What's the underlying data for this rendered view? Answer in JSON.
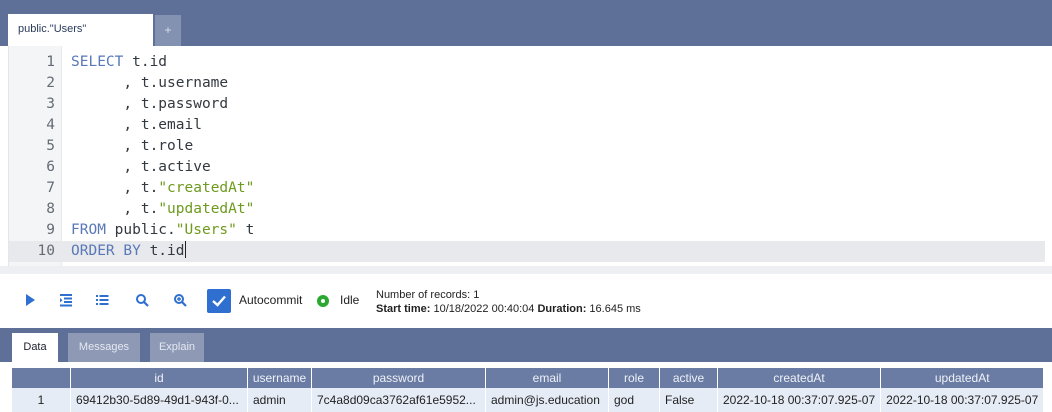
{
  "editor_tabs": {
    "active": "public.\"Users\"",
    "add_label": "+"
  },
  "editor": {
    "lines": [
      {
        "n": "1",
        "parts": [
          {
            "t": "kw",
            "v": "SELECT"
          },
          {
            "t": "p",
            "v": " t.id"
          }
        ]
      },
      {
        "n": "2",
        "parts": [
          {
            "t": "p",
            "v": "      , t.username"
          }
        ]
      },
      {
        "n": "3",
        "parts": [
          {
            "t": "p",
            "v": "      , t.password"
          }
        ]
      },
      {
        "n": "4",
        "parts": [
          {
            "t": "p",
            "v": "      , t.email"
          }
        ]
      },
      {
        "n": "5",
        "parts": [
          {
            "t": "p",
            "v": "      , t.role"
          }
        ]
      },
      {
        "n": "6",
        "parts": [
          {
            "t": "p",
            "v": "      , t.active"
          }
        ]
      },
      {
        "n": "7",
        "parts": [
          {
            "t": "p",
            "v": "      , t."
          },
          {
            "t": "str",
            "v": "\"createdAt\""
          }
        ]
      },
      {
        "n": "8",
        "parts": [
          {
            "t": "p",
            "v": "      , t."
          },
          {
            "t": "str",
            "v": "\"updatedAt\""
          }
        ]
      },
      {
        "n": "9",
        "parts": [
          {
            "t": "kw",
            "v": "FROM"
          },
          {
            "t": "p",
            "v": " public."
          },
          {
            "t": "str",
            "v": "\"Users\""
          },
          {
            "t": "p",
            "v": " t"
          }
        ]
      },
      {
        "n": "10",
        "parts": [
          {
            "t": "kw",
            "v": "ORDER BY"
          },
          {
            "t": "p",
            "v": " t.id"
          }
        ],
        "active": true
      }
    ]
  },
  "toolbar": {
    "icons": [
      "run-icon",
      "format-icon",
      "list-icon",
      "search-icon",
      "zoom-in-icon"
    ],
    "autocommit_label": "Autocommit",
    "status_label": "Idle",
    "records": "Number of records: 1",
    "start_time_label": "Start time:",
    "start_time": "10/18/2022 00:40:04",
    "duration_label": "Duration:",
    "duration": "16.645 ms"
  },
  "result_tabs": [
    "Data",
    "Messages",
    "Explain"
  ],
  "grid": {
    "columns": [
      "id",
      "username",
      "password",
      "email",
      "role",
      "active",
      "createdAt",
      "updatedAt"
    ],
    "rows": [
      [
        "1",
        "69412b30-5d89-49d1-943f-0...",
        "admin",
        "7c4a8d09ca3762af61e5952...",
        "admin@js.education",
        "god",
        "False",
        "2022-10-18 00:37:07.925-07",
        "2022-10-18 00:37:07.925-07"
      ]
    ]
  },
  "colors": {
    "header_bar": "#5e7098",
    "keyword": "#5878b8",
    "string": "#6e9a1e",
    "accent": "#2f6fd0",
    "status_ok": "#2aa830"
  }
}
